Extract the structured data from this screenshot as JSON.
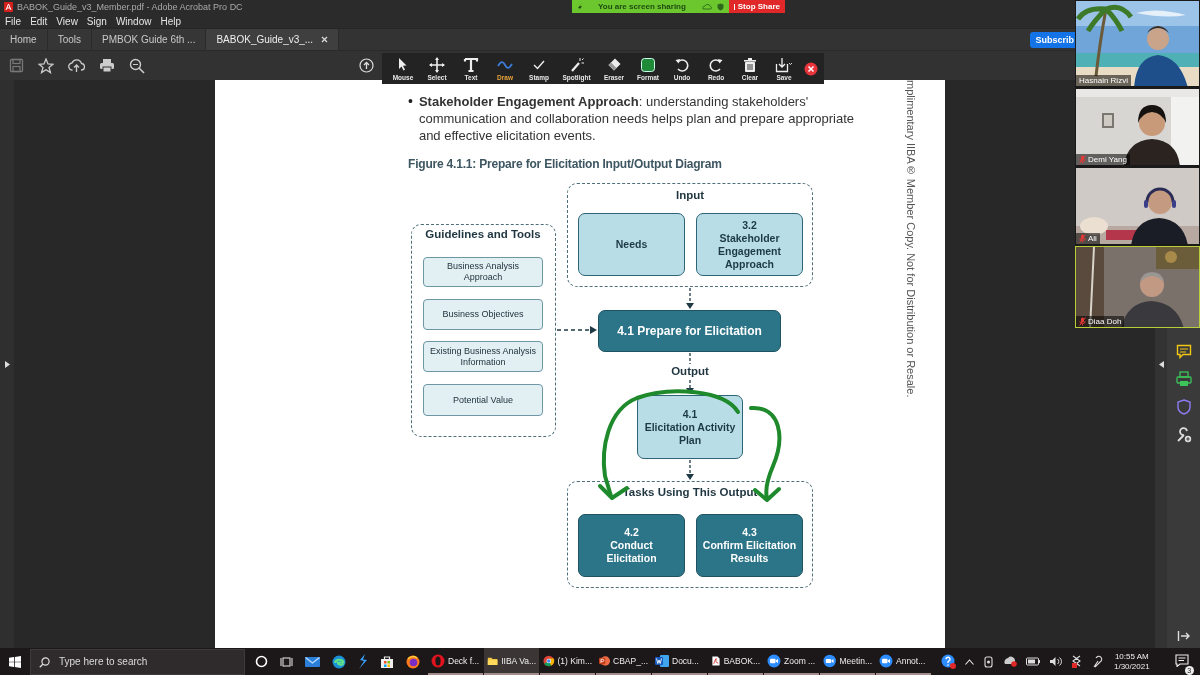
{
  "window": {
    "title": "BABOK_Guide_v3_Member.pdf - Adobe Acrobat Pro DC"
  },
  "menu": [
    "File",
    "Edit",
    "View",
    "Sign",
    "Window",
    "Help"
  ],
  "tabs": [
    {
      "label": "Home",
      "selected": false,
      "closable": false
    },
    {
      "label": "Tools",
      "selected": false,
      "closable": false
    },
    {
      "label": "PMBOK Guide 6th ...",
      "selected": false,
      "closable": false
    },
    {
      "label": "BABOK_Guide_v3_...",
      "selected": true,
      "closable": true
    }
  ],
  "subscribe_button": "Subscrib",
  "share_banner": {
    "status": "You are screen sharing",
    "stop_button": "Stop Share"
  },
  "annotation_toolbar": {
    "tools": [
      {
        "label": "Mouse",
        "kind": "mouse",
        "selected": false
      },
      {
        "label": "Select",
        "kind": "select",
        "selected": false
      },
      {
        "label": "Text",
        "kind": "text",
        "selected": false
      },
      {
        "label": "Draw",
        "kind": "draw",
        "selected": true
      },
      {
        "label": "Stamp",
        "kind": "stamp",
        "selected": false
      },
      {
        "label": "Spotlight",
        "kind": "spotlight",
        "selected": false
      },
      {
        "label": "Eraser",
        "kind": "eraser",
        "selected": false
      },
      {
        "label": "Format",
        "kind": "format",
        "selected": false
      },
      {
        "label": "Undo",
        "kind": "undo",
        "selected": false
      },
      {
        "label": "Redo",
        "kind": "redo",
        "selected": false
      },
      {
        "label": "Clear",
        "kind": "clear",
        "selected": false
      },
      {
        "label": "Save",
        "kind": "save",
        "selected": false
      }
    ]
  },
  "document": {
    "bullet": "•",
    "paragraph": "**Stakeholder Engagement Approach**: understanding stakeholders' communication and collaboration needs helps plan and prepare appropriate and effective elicitation events.",
    "figure_caption": "Figure 4.1.1: Prepare for Elicitation Input/Output Diagram",
    "side_note": "mplimentary IIBA® Member Copy. Not for Distribution or Resale.",
    "diagram": {
      "input": {
        "label": "Input",
        "nodes": [
          {
            "title": "Needs",
            "kind": "light"
          },
          {
            "number": "3.2",
            "title": "Stakeholder Engagement Approach",
            "kind": "light"
          }
        ]
      },
      "guidelines": {
        "label": "Guidelines and Tools",
        "items": [
          "Business Analysis Approach",
          "Business Objectives",
          "Existing Business Analysis Information",
          "Potential Value"
        ]
      },
      "task": {
        "title": "4.1 Prepare for Elicitation",
        "kind": "dark"
      },
      "output_label": "Output",
      "output": {
        "number": "4.1",
        "title": "Elicitation Activity Plan",
        "kind": "light"
      },
      "tasks_using": {
        "label": "Tasks Using This Output",
        "nodes": [
          {
            "number": "4.2",
            "title": "Conduct Elicitation",
            "kind": "dark"
          },
          {
            "number": "4.3",
            "title": "Confirm Elicitation Results",
            "kind": "dark"
          }
        ]
      }
    }
  },
  "participants": [
    {
      "name": "Hasnain Rizvi",
      "muted": false,
      "active_speaker": false
    },
    {
      "name": "Demi Yang",
      "muted": true,
      "active_speaker": false
    },
    {
      "name": "Ali",
      "muted": true,
      "active_speaker": false
    },
    {
      "name": "Diaa Doh",
      "muted": true,
      "active_speaker": true
    }
  ],
  "taskbar": {
    "search_placeholder": "Type here to search",
    "apps": [
      {
        "label": "Deck f...",
        "kind": "opera",
        "selected": false
      },
      {
        "label": "IIBA Va...",
        "kind": "folder",
        "selected": true
      },
      {
        "label": "(1) Kim...",
        "kind": "chrome",
        "selected": false
      },
      {
        "label": "CBAP_...",
        "kind": "powerpoint",
        "selected": false
      },
      {
        "label": "Docu...",
        "kind": "word",
        "selected": false
      },
      {
        "label": "BABOK...",
        "kind": "acrobat",
        "selected": false
      },
      {
        "label": "Zoom ...",
        "kind": "zoom",
        "selected": false
      },
      {
        "label": "Meetin...",
        "kind": "zoom",
        "selected": false
      },
      {
        "label": "Annot...",
        "kind": "zoom",
        "selected": false
      }
    ],
    "time": "10:55 AM",
    "date": "1/30/2021",
    "notification_count": "3"
  }
}
